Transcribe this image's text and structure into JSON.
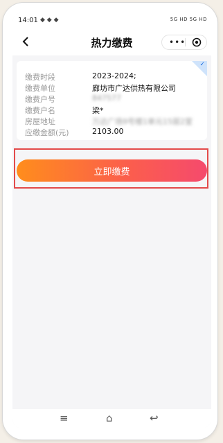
{
  "status": {
    "time": "14:01",
    "network": "5G HD 5G HD"
  },
  "nav": {
    "title": "热力缴费"
  },
  "bill": {
    "rows": [
      {
        "label": "缴费时段",
        "value": "2023-2024;"
      },
      {
        "label": "缴费单位",
        "value": "廊坊市广达供热有限公司"
      },
      {
        "label": "缴费户号",
        "value": "847577"
      },
      {
        "label": "缴费户名",
        "value": "梁*"
      },
      {
        "label": "房屋地址",
        "value": "万达广场9号楼1单元15层2室"
      },
      {
        "label": "应缴金额(元)",
        "value": "2103.00"
      }
    ]
  },
  "actions": {
    "pay_label": "立即缴费"
  },
  "colors": {
    "accent_start": "#ff8d1c",
    "accent_end": "#f54a6d",
    "highlight_box": "#e34a4a"
  },
  "icons": {
    "back": "chevron-left-icon",
    "more": "more-dots-icon",
    "close": "target-circle-icon",
    "check": "check-icon",
    "home_menu": "menu-icon",
    "home": "home-icon",
    "back_nav": "back-arrow-icon"
  }
}
